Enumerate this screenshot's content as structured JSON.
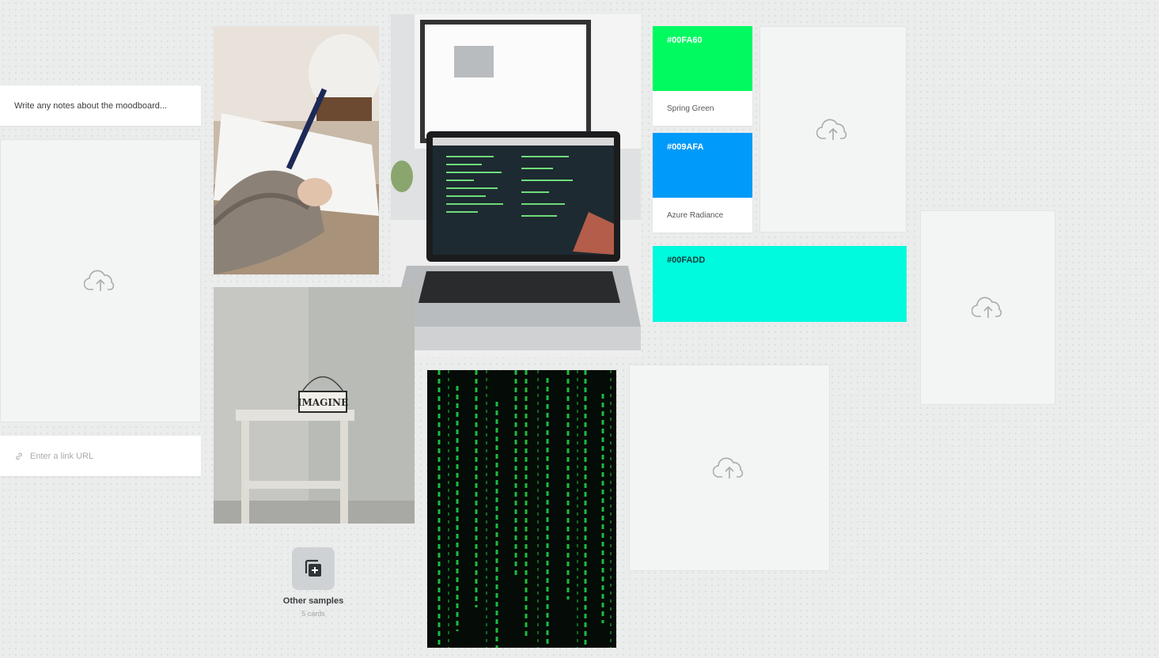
{
  "notes": {
    "placeholder": "Write any notes about the moodboard..."
  },
  "link": {
    "placeholder": "Enter a link URL",
    "icon": "link-icon"
  },
  "colors": [
    {
      "hex": "#00FA60",
      "name": "Spring Green"
    },
    {
      "hex": "#009AFA",
      "name": "Azure Radiance"
    },
    {
      "hex": "#00FADD",
      "name": ""
    }
  ],
  "upload_icon": "cloud-upload-icon",
  "samples": {
    "title": "Other samples",
    "count": "5 cards",
    "icon": "add-stack-icon"
  },
  "photos": [
    "writing-hand-photo",
    "laptop-code-photo",
    "imagine-stool-photo",
    "matrix-code-photo"
  ]
}
